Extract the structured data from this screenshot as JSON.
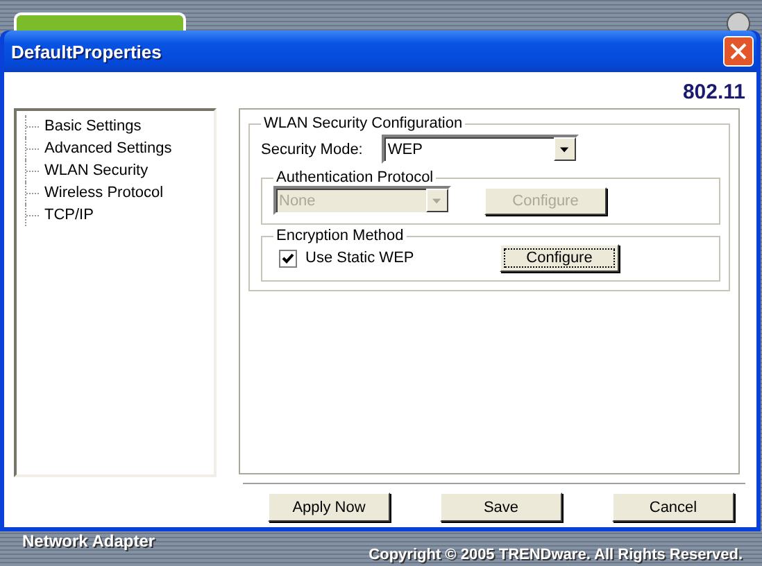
{
  "window": {
    "title": "DefaultProperties",
    "badge": "802.11"
  },
  "tree": [
    {
      "label": "Basic Settings",
      "selected": false
    },
    {
      "label": "Advanced Settings",
      "selected": false
    },
    {
      "label": "WLAN Security",
      "selected": false
    },
    {
      "label": "Wireless Protocol",
      "selected": false
    },
    {
      "label": "TCP/IP",
      "selected": false
    }
  ],
  "security": {
    "title": "WLAN Security Configuration",
    "mode_label": "Security Mode:",
    "mode_value": "WEP",
    "auth": {
      "title": "Authentication Protocol",
      "value": "None",
      "disabled": true,
      "button": "Configure"
    },
    "encryption": {
      "title": "Encryption Method",
      "checkbox_label": "Use Static WEP",
      "checked": true,
      "button": "Configure",
      "focused": true
    }
  },
  "buttons": [
    "Apply Now",
    "Save",
    "Cancel"
  ],
  "app": {
    "footer_label": "Network Adapter",
    "copyright": "Copyright © 2005 TRENDware. All Rights Reserved."
  }
}
